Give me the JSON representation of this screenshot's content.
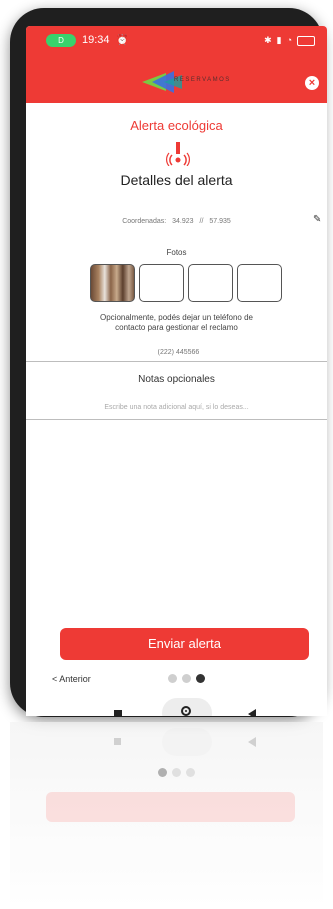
{
  "status_bar": {
    "time": "19:34",
    "battery_pill_label": "D"
  },
  "header": {
    "logo_text": "RESERVAMOS",
    "close_icon": "close-icon"
  },
  "page": {
    "title": "Alerta ecológica",
    "alert_icon": "alert-broadcast-icon",
    "section_title": "Detalles del alerta"
  },
  "coordinates": {
    "label": "Coordenadas:",
    "lat": "34.923",
    "separator": "//",
    "lng": "57.935",
    "edit_icon": "pencil-icon"
  },
  "photos": {
    "label": "Fotos",
    "slots": [
      {
        "filled": true
      },
      {
        "filled": false
      },
      {
        "filled": false
      },
      {
        "filled": false
      }
    ]
  },
  "contact": {
    "helper_text": "Opcionalmente, podés dejar un teléfono de contacto para gestionar el reclamo",
    "phone_placeholder": "(222) 445566"
  },
  "notes": {
    "title": "Notas opcionales",
    "placeholder": "Escribe una nota adicional aquí, si lo deseas..."
  },
  "actions": {
    "send_label": "Enviar alerta",
    "prev_label": "< Anterior"
  },
  "pagination": {
    "total": 3,
    "active_index": 2
  },
  "colors": {
    "accent": "#ee3a35",
    "battery_green": "#39d26c"
  }
}
